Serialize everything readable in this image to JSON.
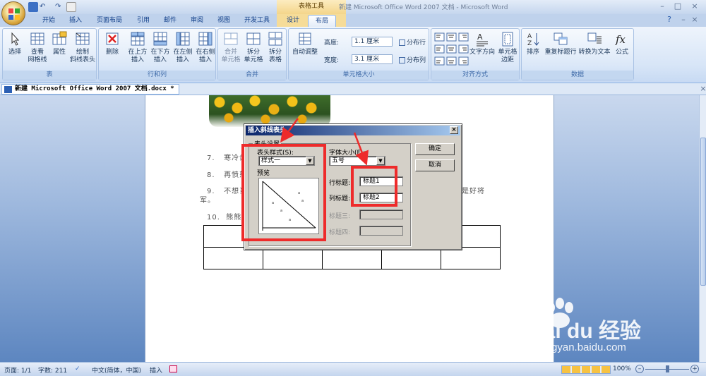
{
  "window": {
    "title": "新建 Microsoft Office Word 2007 文档 - Microsoft Word",
    "context_tools_label": "表格工具"
  },
  "tabs": [
    "开始",
    "插入",
    "页面布局",
    "引用",
    "邮件",
    "审阅",
    "视图",
    "开发工具",
    "设计",
    "布局"
  ],
  "active_tab": "布局",
  "ribbon": {
    "groups": {
      "table": "表",
      "rows_cols": "行和列",
      "merge": "合并",
      "cell_size": "单元格大小",
      "alignment": "对齐方式",
      "data": "数据"
    },
    "buttons": {
      "select": "选择",
      "view_gridlines": "查看\n网格线",
      "properties": "属性",
      "draw_diagonal": "绘制\n斜线表头",
      "delete": "删除",
      "insert_above": "在上方\n插入",
      "insert_below": "在下方\n插入",
      "insert_left": "在左侧\n插入",
      "insert_right": "在右侧\n插入",
      "merge_cells": "合并\n单元格",
      "split_cells": "拆分\n单元格",
      "split_table": "拆分\n表格",
      "autofit": "自动调整",
      "height_label": "高度:",
      "height_value": "1.1 厘米",
      "width_label": "宽度:",
      "width_value": "3.1 厘米",
      "distribute_rows": "分布行",
      "distribute_cols": "分布列",
      "text_direction": "文字方向",
      "cell_margins": "单元格\n边距",
      "sort": "排序",
      "repeat_header": "重复标题行",
      "convert_to_text": "转换为文本",
      "formula": "公式"
    }
  },
  "document_tab": "新建 Microsoft Office Word 2007 文档.docx *",
  "document": {
    "lines": [
      {
        "num": "7.",
        "text": "寒冷剑"
      },
      {
        "num": "8.",
        "text": "再愤怒"
      },
      {
        "num": "9.",
        "text": "不想当",
        "tail": "是好将"
      },
      {
        "num": "",
        "text": "军。"
      },
      {
        "num": "10.",
        "text": "熊熊"
      }
    ]
  },
  "dialog": {
    "title": "插入斜线表头",
    "section_label": "表头设置",
    "style_label": "表头样式(S):",
    "style_value": "样式一",
    "preview_label": "预览",
    "font_size_label": "字体大小(F):",
    "font_size_value": "五号",
    "row_title_label": "行标题:",
    "row_title_value": "标题1",
    "col_title_label": "列标题:",
    "col_title_value": "标题2",
    "title3_label": "标题三:",
    "title4_label": "标题四:",
    "ok": "确定",
    "cancel": "取消"
  },
  "status": {
    "page": "页面: 1/1",
    "words": "字数: 211",
    "language": "中文(简体，中国)",
    "mode": "插入",
    "zoom": "100%"
  },
  "watermark": {
    "brand": "Bai du 经验",
    "url": "jingyan.baidu.com"
  },
  "colors": {
    "highlight_red": "#ee2b2b",
    "dialog_title": "#0a246a"
  }
}
